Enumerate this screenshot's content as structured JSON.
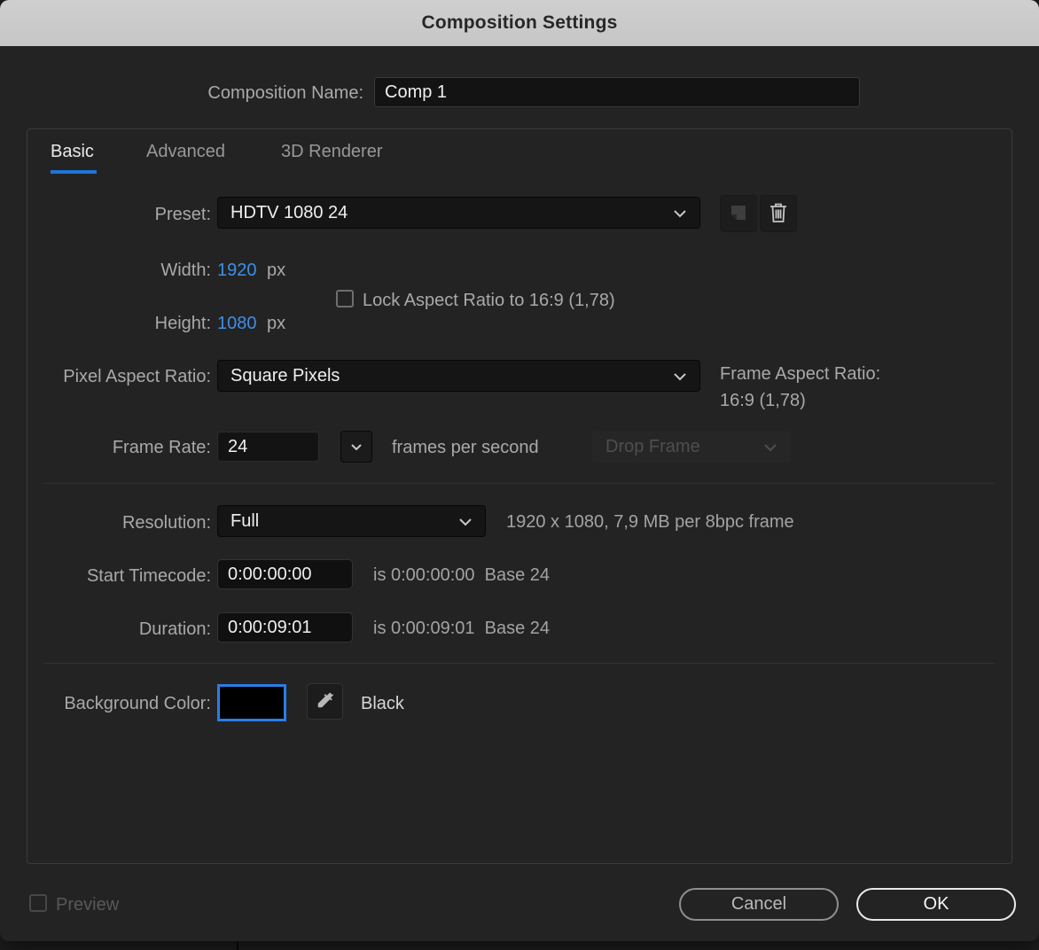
{
  "window": {
    "title": "Composition Settings"
  },
  "composition_name": {
    "label": "Composition Name:",
    "value": "Comp 1"
  },
  "tabs": [
    {
      "label": "Basic",
      "active": true
    },
    {
      "label": "Advanced",
      "active": false
    },
    {
      "label": "3D Renderer",
      "active": false
    }
  ],
  "preset": {
    "label": "Preset:",
    "value": "HDTV 1080 24"
  },
  "width_field": {
    "label": "Width:",
    "value": "1920",
    "unit": "px"
  },
  "height_field": {
    "label": "Height:",
    "value": "1080",
    "unit": "px"
  },
  "lock_aspect": {
    "label": "Lock Aspect Ratio to 16:9 (1,78)",
    "checked": false
  },
  "pixel_aspect_ratio": {
    "label": "Pixel Aspect Ratio:",
    "value": "Square Pixels"
  },
  "frame_aspect_ratio": {
    "label": "Frame Aspect Ratio:",
    "value": "16:9 (1,78)"
  },
  "frame_rate": {
    "label": "Frame Rate:",
    "value": "24",
    "suffix": "frames per second",
    "drop_frame_label": "Drop Frame",
    "drop_frame_enabled": false
  },
  "resolution": {
    "label": "Resolution:",
    "value": "Full",
    "info": "1920 x 1080, 7,9 MB per 8bpc frame"
  },
  "start_timecode": {
    "label": "Start Timecode:",
    "value": "0:00:00:00",
    "info": "is 0:00:00:00  Base 24"
  },
  "duration": {
    "label": "Duration:",
    "value": "0:00:09:01",
    "info": "is 0:00:09:01  Base 24"
  },
  "background_color": {
    "label": "Background Color:",
    "value": "Black",
    "swatch_hex": "#000000"
  },
  "preview": {
    "label": "Preview",
    "checked": false
  },
  "buttons": {
    "cancel": "Cancel",
    "ok": "OK"
  },
  "colors": {
    "accent_blue": "#1f76d8",
    "value_blue": "#3d8fe8",
    "swatch_border_blue": "#2a7de6",
    "titlebar_gray": "#c9c9c9",
    "dialog_bg": "#232323"
  }
}
